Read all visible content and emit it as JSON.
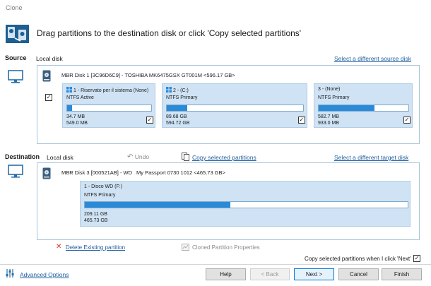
{
  "window": {
    "title": "Clone"
  },
  "header": {
    "text": "Drag partitions to the destination disk or click 'Copy selected partitions'"
  },
  "source": {
    "label": "Source",
    "disk_label": "Local disk",
    "select_link": "Select a different source disk",
    "disk_title": "MBR Disk 1 [3C96D6C9] - TOSHIBA MK6475GSX GT001M  <596.17 GB>",
    "partitions": [
      {
        "name": "1 - Riservato per il sistema (None)",
        "type": "NTFS Active",
        "used": "34.7 MB",
        "total": "549.0 MB",
        "fill": 0.06
      },
      {
        "name": "2 - (C:)",
        "type": "NTFS Primary",
        "used": "89.68 GB",
        "total": "594.72 GB",
        "fill": 0.15
      },
      {
        "name": "3 - (None)",
        "type": "NTFS Primary",
        "used": "582.7 MB",
        "total": "933.0 MB",
        "fill": 0.62
      }
    ]
  },
  "destination": {
    "label": "Destination",
    "disk_label": "Local disk",
    "undo_label": "Undo",
    "copy_link": "Copy selected partitions",
    "select_link": "Select a different target disk",
    "disk_title": "MBR Disk 3 [000521AB] - WD",
    "disk_model": "My Passport 0730 1012  <465.73 GB>",
    "partition": {
      "name": "1 - Disco WD (F:)",
      "type": "NTFS Primary",
      "used": "209.11 GB",
      "total": "465.73 GB",
      "fill": 0.45
    }
  },
  "actions": {
    "delete_link": "Delete Existing partition",
    "cloned_props": "Cloned Partition Properties",
    "copy_next_label": "Copy selected partitions when I click 'Next'"
  },
  "footer": {
    "advanced": "Advanced Options",
    "help": "Help",
    "back": "< Back",
    "next": "Next >",
    "cancel": "Cancel",
    "finish": "Finish"
  },
  "colors": {
    "accent": "#2b8ad8",
    "partition_bg": "#cfe3f4",
    "link": "#1f5fa0",
    "delete_x": "#d83b2a"
  }
}
